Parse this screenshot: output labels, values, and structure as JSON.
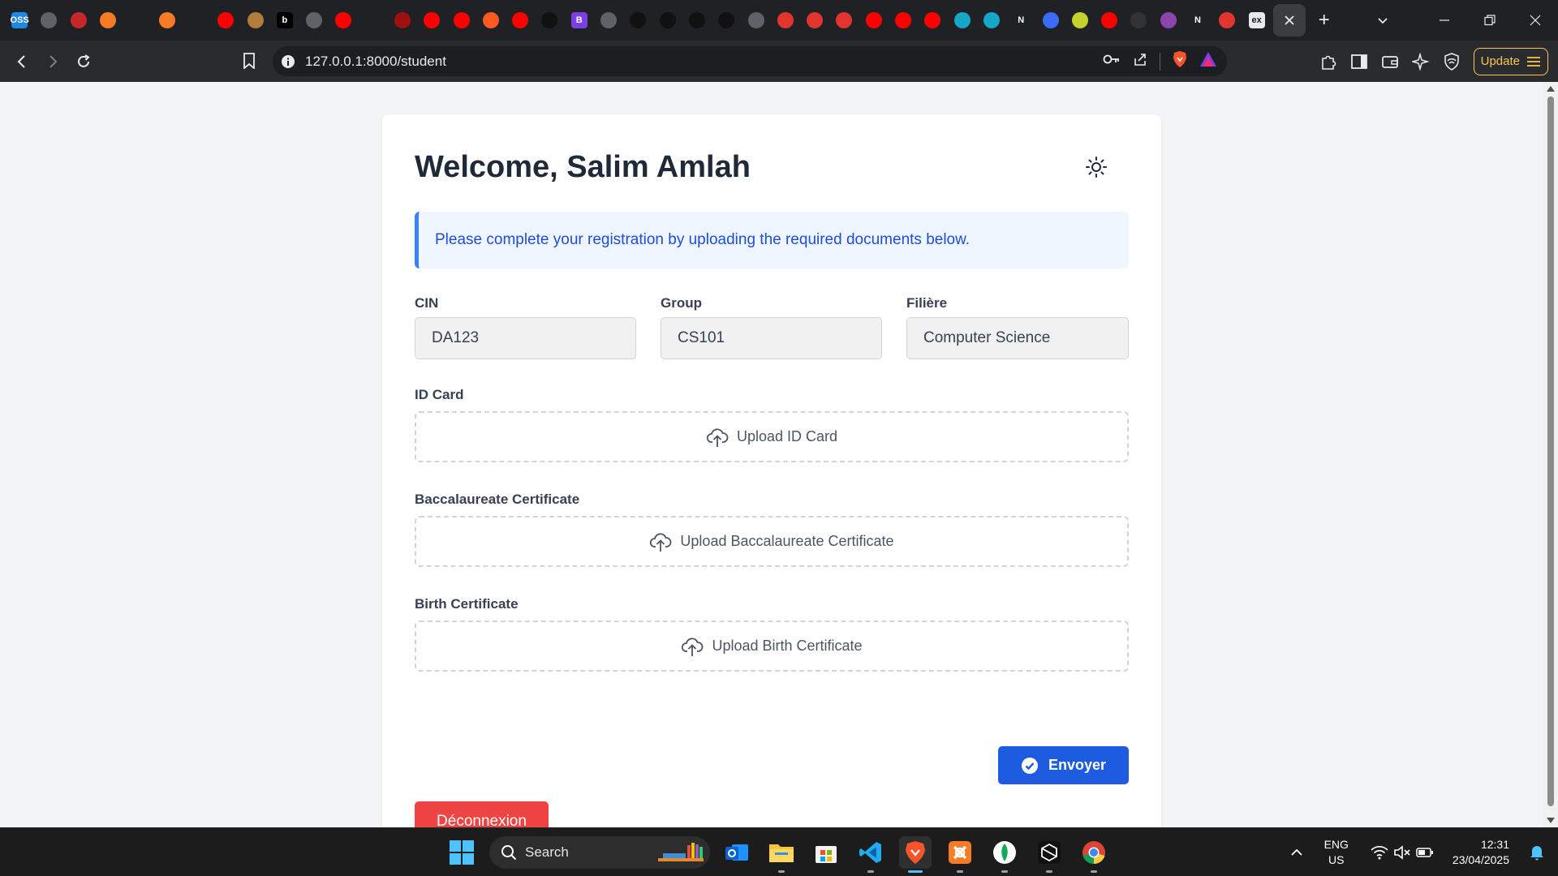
{
  "browser": {
    "tab_favicons": [
      {
        "text": "OSS",
        "color": "#1e88e5"
      },
      {
        "text": "",
        "color": "#5f6368"
      },
      {
        "text": "",
        "color": "#c62828"
      },
      {
        "text": "",
        "color": "#fb7a24"
      },
      {
        "text": "",
        "color": "#202124"
      },
      {
        "text": "",
        "color": "#fb7a24"
      },
      {
        "text": "",
        "color": "#202124"
      },
      {
        "text": "",
        "color": "#ff0000"
      },
      {
        "text": "",
        "color": "#b07d3b"
      },
      {
        "text": "b",
        "color": "#000000"
      },
      {
        "text": "",
        "color": "#5f6368"
      },
      {
        "text": "",
        "color": "#ff0000"
      },
      {
        "text": "",
        "color": "#202124"
      },
      {
        "text": "",
        "color": "#a01010"
      },
      {
        "text": "",
        "color": "#ff0000"
      },
      {
        "text": "",
        "color": "#ff0000"
      },
      {
        "text": "",
        "color": "#ff5a1f"
      },
      {
        "text": "",
        "color": "#ff0000"
      },
      {
        "text": "",
        "color": "#111111"
      },
      {
        "text": "B",
        "color": "#7b3fe4"
      },
      {
        "text": "",
        "color": "#5f6368"
      },
      {
        "text": "",
        "color": "#111111"
      },
      {
        "text": "",
        "color": "#111111"
      },
      {
        "text": "",
        "color": "#111111"
      },
      {
        "text": "",
        "color": "#111111"
      },
      {
        "text": "",
        "color": "#5f6368"
      },
      {
        "text": "",
        "color": "#e3342f"
      },
      {
        "text": "",
        "color": "#e3342f"
      },
      {
        "text": "",
        "color": "#e3342f"
      },
      {
        "text": "",
        "color": "#ff0000"
      },
      {
        "text": "",
        "color": "#ff0000"
      },
      {
        "text": "",
        "color": "#ff0000"
      },
      {
        "text": "",
        "color": "#16a6c9"
      },
      {
        "text": "",
        "color": "#16a6c9"
      },
      {
        "text": "N",
        "color": "#202124"
      },
      {
        "text": "",
        "color": "#3b6cf6"
      },
      {
        "text": "",
        "color": "#c5d22b"
      },
      {
        "text": "",
        "color": "#ff0000"
      },
      {
        "text": "",
        "color": "#333333"
      },
      {
        "text": "",
        "color": "#8e44ad"
      },
      {
        "text": "N",
        "color": "#202124"
      },
      {
        "text": "",
        "color": "#e3342f"
      },
      {
        "text": "ex",
        "color": "#e8eaed"
      }
    ],
    "url": "127.0.0.1:8000/student",
    "update_label": "Update"
  },
  "page": {
    "welcome_title": "Welcome, Salim Amlah",
    "notice": "Please complete your registration by uploading the required documents below.",
    "fields": {
      "cin": {
        "label": "CIN",
        "value": "DA123"
      },
      "group": {
        "label": "Group",
        "value": "CS101"
      },
      "filiere": {
        "label": "Filière",
        "value": "Computer Science"
      }
    },
    "uploads": {
      "id_card": {
        "label": "ID Card",
        "button": "Upload ID Card"
      },
      "bac": {
        "label": "Baccalaureate Certificate",
        "button": "Upload Baccalaureate Certificate"
      },
      "birth": {
        "label": "Birth Certificate",
        "button": "Upload Birth Certificate"
      }
    },
    "submit_label": "Envoyer",
    "logout_label": "Déconnexion",
    "colors": {
      "primary": "#1d5be0",
      "danger": "#ef4444",
      "notice_border": "#3b82f6"
    }
  },
  "taskbar": {
    "search_label": "Search",
    "apps": [
      "outlook",
      "file-explorer",
      "microsoft-store",
      "vscode",
      "brave",
      "xampp",
      "mongodb-compass",
      "cursor",
      "chrome"
    ],
    "lang_line1": "ENG",
    "lang_line2": "US",
    "time": "12:31",
    "date": "23/04/2025"
  }
}
